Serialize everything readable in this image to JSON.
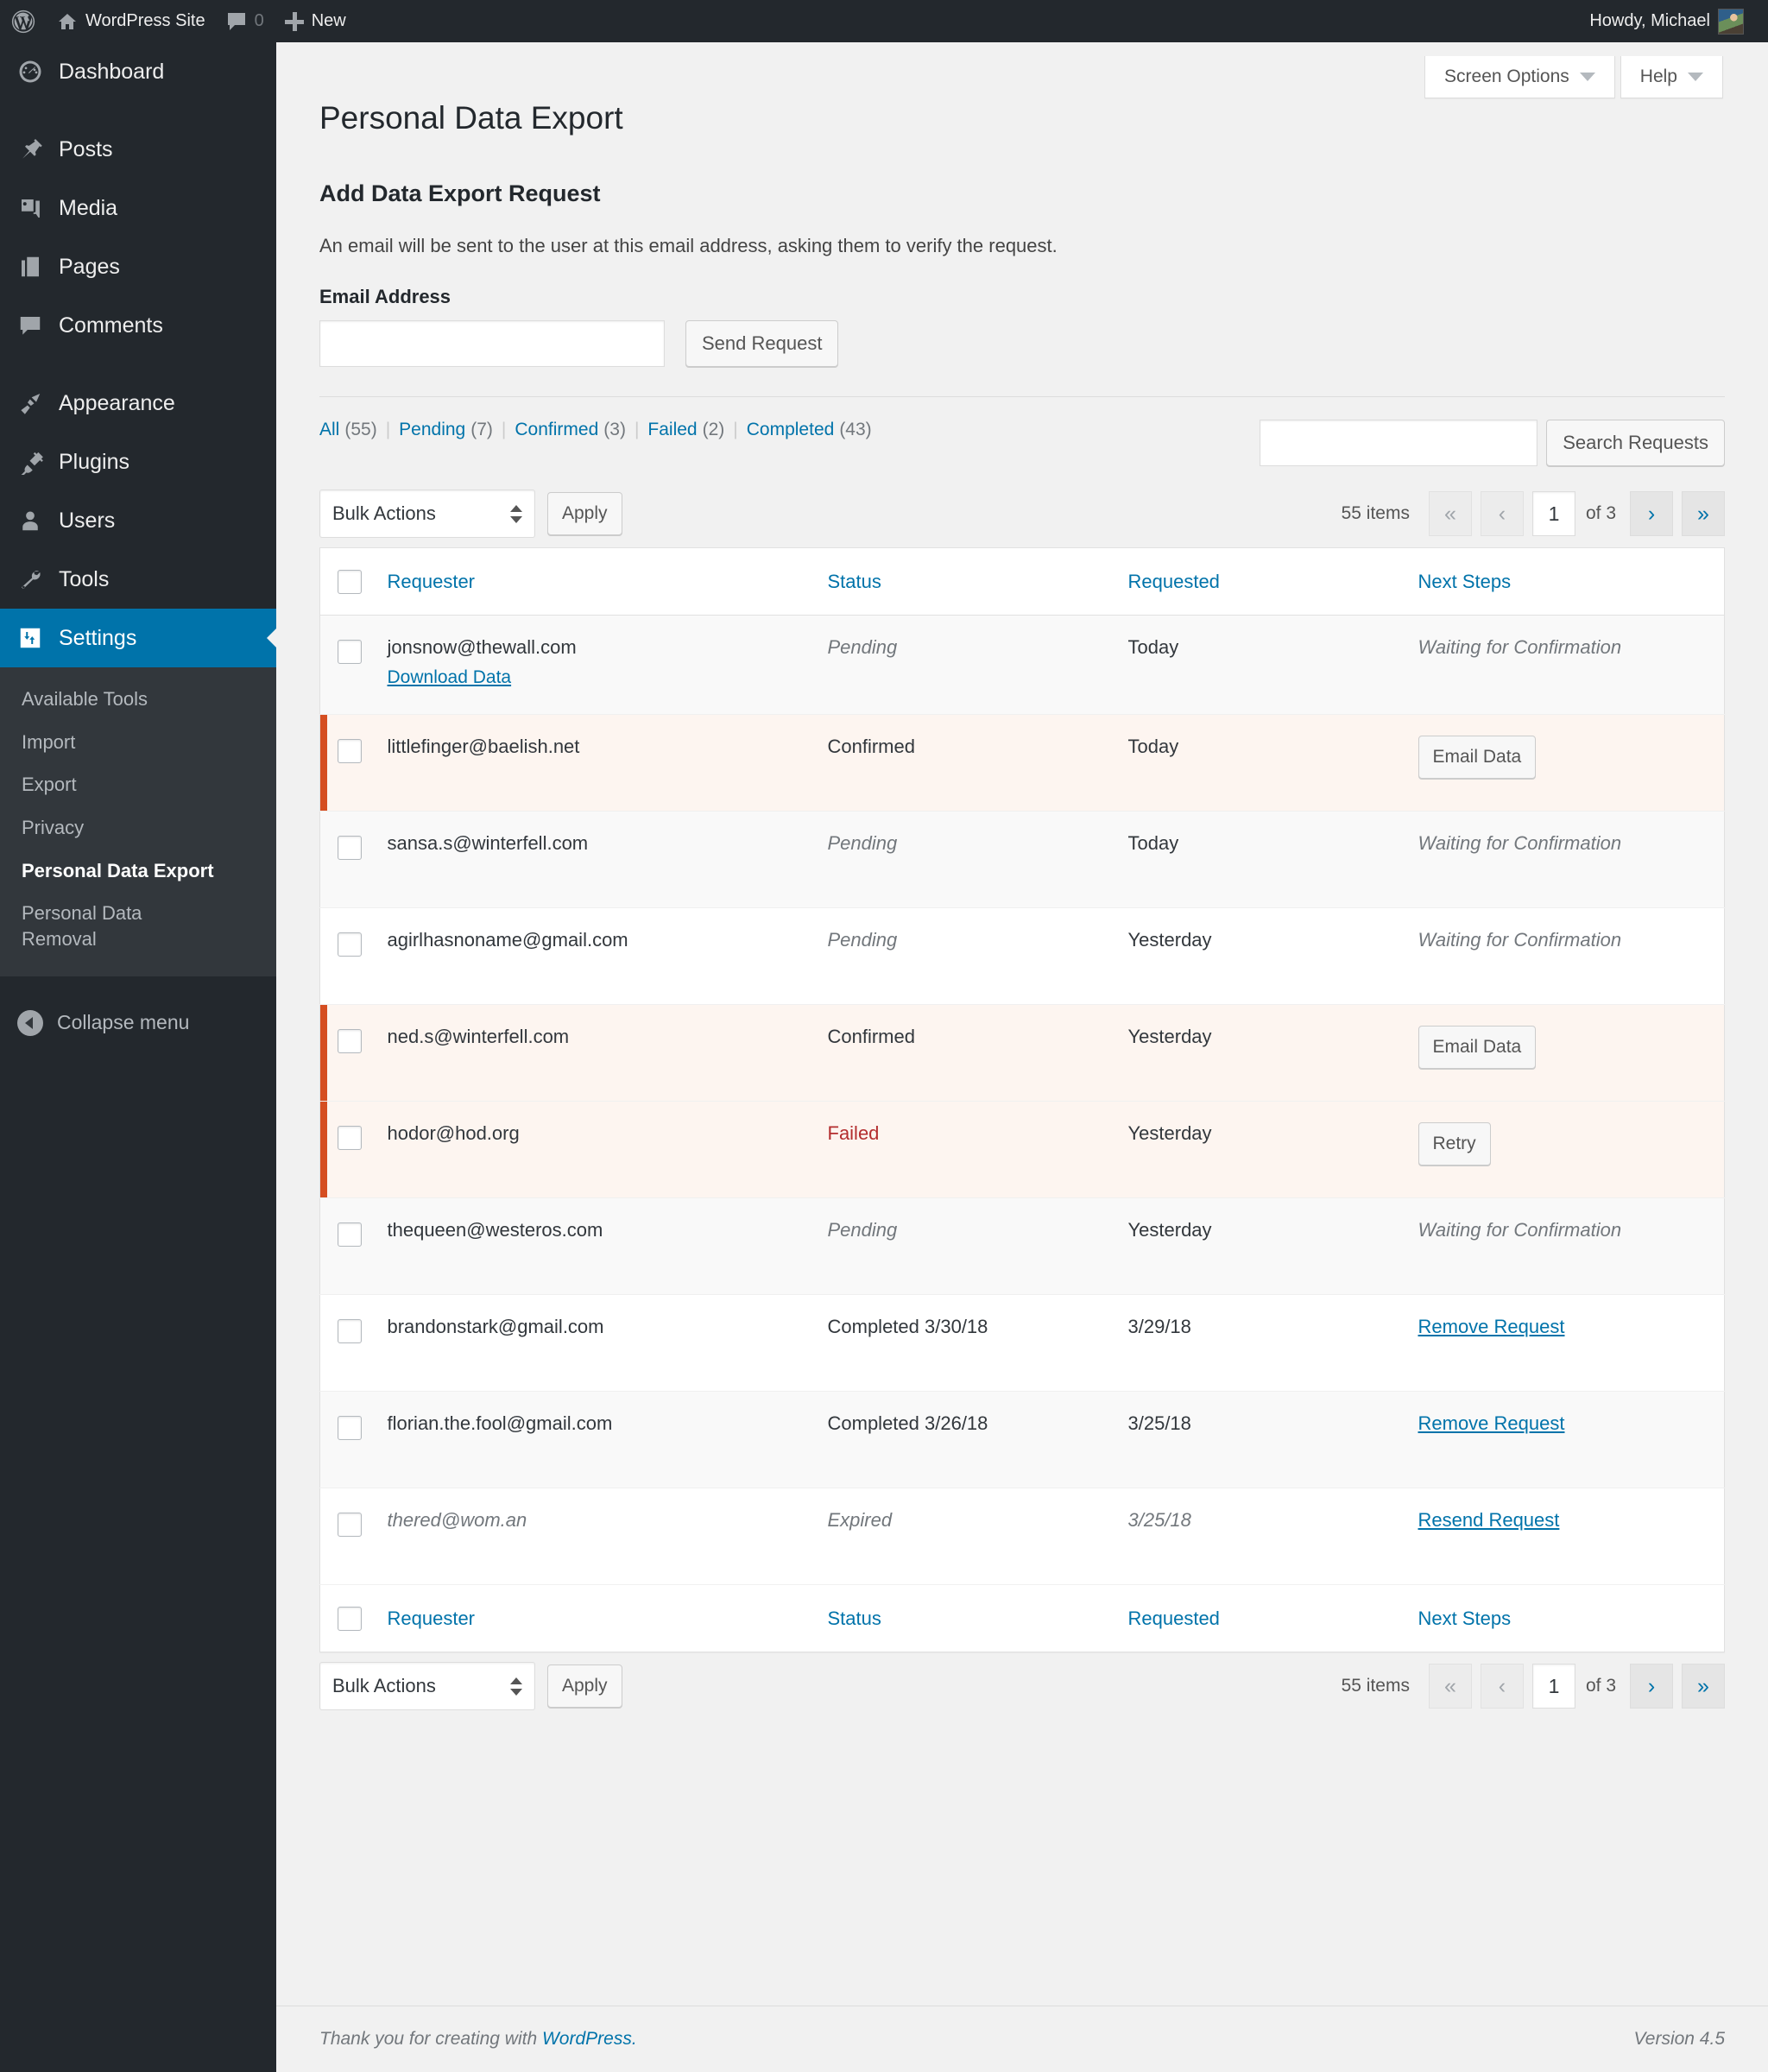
{
  "adminbar": {
    "site_name": "WordPress Site",
    "comment_count": "0",
    "new_label": "New",
    "howdy": "Howdy, Michael"
  },
  "sidebar": {
    "items": [
      {
        "label": "Dashboard",
        "icon": "dashboard-icon"
      },
      {
        "label": "Posts",
        "icon": "pin-icon"
      },
      {
        "label": "Media",
        "icon": "media-icon"
      },
      {
        "label": "Pages",
        "icon": "pages-icon"
      },
      {
        "label": "Comments",
        "icon": "comment-icon"
      },
      {
        "label": "Appearance",
        "icon": "brush-icon"
      },
      {
        "label": "Plugins",
        "icon": "plug-icon"
      },
      {
        "label": "Users",
        "icon": "user-icon"
      },
      {
        "label": "Tools",
        "icon": "wrench-icon"
      },
      {
        "label": "Settings",
        "icon": "settings-icon"
      }
    ],
    "submenu": [
      "Available Tools",
      "Import",
      "Export",
      "Privacy",
      "Personal Data Export",
      "Personal Data Removal"
    ],
    "current_submenu": "Personal Data Export",
    "collapse_label": "Collapse menu"
  },
  "screen_meta": {
    "screen_options": "Screen Options",
    "help": "Help"
  },
  "page": {
    "title": "Personal Data Export",
    "section_title": "Add Data Export Request",
    "section_desc": "An email will be sent to the user at this email address, asking them to verify the request.",
    "email_label": "Email Address",
    "email_value": "",
    "email_placeholder": "",
    "send_button": "Send Request"
  },
  "filters": [
    {
      "label": "All",
      "count": "(55)"
    },
    {
      "label": "Pending",
      "count": "(7)"
    },
    {
      "label": "Confirmed",
      "count": "(3)"
    },
    {
      "label": "Failed",
      "count": "(2)"
    },
    {
      "label": "Completed",
      "count": "(43)"
    }
  ],
  "search": {
    "value": "",
    "placeholder": "",
    "button": "Search Requests"
  },
  "tablenav": {
    "bulk_actions": "Bulk Actions",
    "apply": "Apply",
    "displaying_num": "55 items",
    "first": "«",
    "prev": "‹",
    "current_page": "1",
    "of_total": "of 3",
    "next": "›",
    "last": "»"
  },
  "table": {
    "columns": [
      "Requester",
      "Status",
      "Requested",
      "Next Steps"
    ],
    "rows": [
      {
        "email": "jonsnow@thewall.com",
        "sub_link": "Download Data",
        "status": "Pending",
        "status_style": "italic",
        "requested": "Today",
        "next": "Waiting for Confirmation",
        "next_type": "italic",
        "highlight": false,
        "stripe": true
      },
      {
        "email": "littlefinger@baelish.net",
        "sub_link": "",
        "status": "Confirmed",
        "status_style": "plain",
        "requested": "Today",
        "next": "Email Data",
        "next_type": "button",
        "highlight": true,
        "stripe": false
      },
      {
        "email": "sansa.s@winterfell.com",
        "sub_link": "",
        "status": "Pending",
        "status_style": "italic",
        "requested": "Today",
        "next": "Waiting for Confirmation",
        "next_type": "italic",
        "highlight": false,
        "stripe": true
      },
      {
        "email": "agirlhasnoname@gmail.com",
        "sub_link": "",
        "status": "Pending",
        "status_style": "italic",
        "requested": "Yesterday",
        "next": "Waiting for Confirmation",
        "next_type": "italic",
        "highlight": false,
        "stripe": false
      },
      {
        "email": "ned.s@winterfell.com",
        "sub_link": "",
        "status": "Confirmed",
        "status_style": "plain",
        "requested": "Yesterday",
        "next": "Email Data",
        "next_type": "button",
        "highlight": true,
        "stripe": true
      },
      {
        "email": "hodor@hod.org",
        "sub_link": "",
        "status": "Failed",
        "status_style": "failed",
        "requested": "Yesterday",
        "next": "Retry",
        "next_type": "button",
        "highlight": true,
        "stripe": false
      },
      {
        "email": "thequeen@westeros.com",
        "sub_link": "",
        "status": "Pending",
        "status_style": "italic",
        "requested": "Yesterday",
        "next": "Waiting for Confirmation",
        "next_type": "italic",
        "highlight": false,
        "stripe": true
      },
      {
        "email": "brandonstark@gmail.com",
        "sub_link": "",
        "status": "Completed 3/30/18",
        "status_style": "plain",
        "requested": "3/29/18",
        "next": "Remove Request",
        "next_type": "link",
        "highlight": false,
        "stripe": false
      },
      {
        "email": "florian.the.fool@gmail.com",
        "sub_link": "",
        "status": "Completed 3/26/18",
        "status_style": "plain",
        "requested": "3/25/18",
        "next": "Remove Request",
        "next_type": "link",
        "highlight": false,
        "stripe": true
      },
      {
        "email": "thered@wom.an",
        "sub_link": "",
        "status": "Expired",
        "status_style": "italic",
        "requested": "3/25/18",
        "next": "Resend Request",
        "next_type": "link",
        "highlight": false,
        "stripe": false,
        "email_style": "expired"
      }
    ]
  },
  "footer": {
    "thanks_prefix": "Thank you for creating with ",
    "wordpress_link": "WordPress.",
    "version": "Version 4.5"
  },
  "colors": {
    "admin_dark": "#23282d",
    "submenu_bg": "#32373c",
    "accent_blue": "#0073aa",
    "highlight_border": "#d54e21",
    "highlight_bg": "#fdf5f0",
    "failed_red": "#b32d2e"
  }
}
